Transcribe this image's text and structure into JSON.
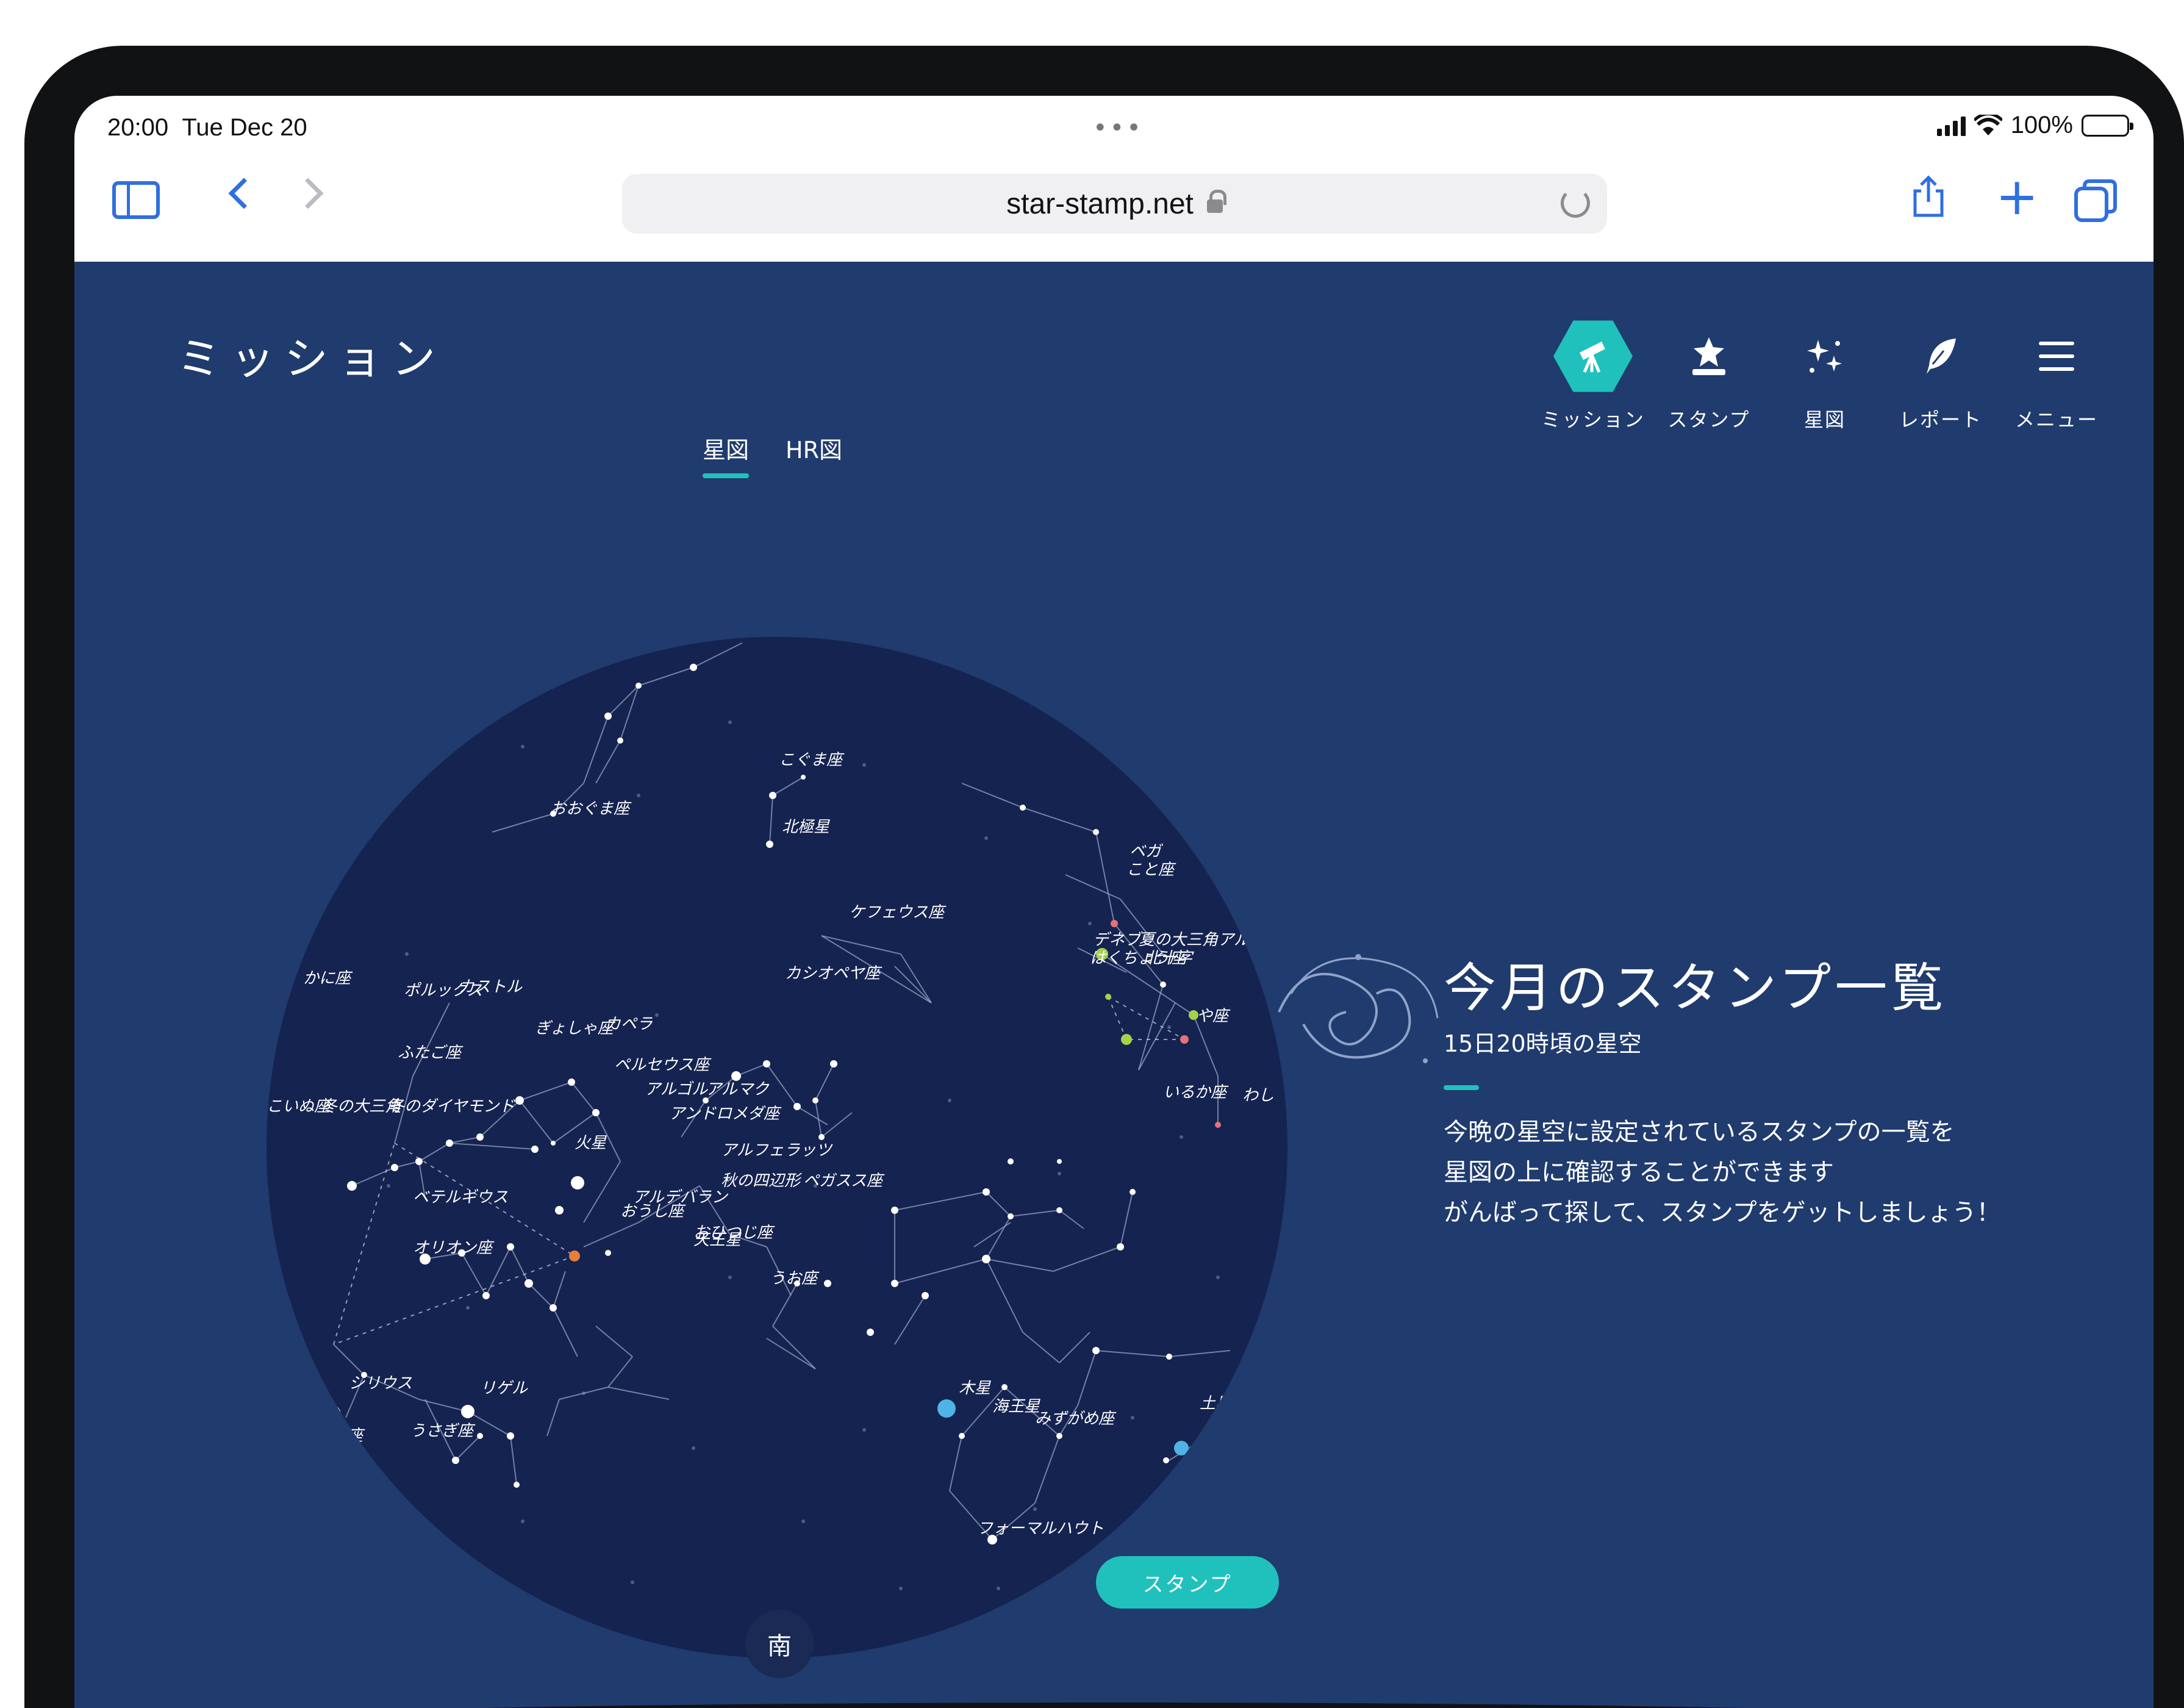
{
  "status_bar": {
    "time": "20:00",
    "date": "Tue Dec 20",
    "dots": "•••",
    "battery": "100%"
  },
  "browser": {
    "url": "star-stamp.net",
    "icons": [
      "sidebar-icon",
      "back-chevron-icon",
      "forward-chevron-icon",
      "lock-icon",
      "reload-icon",
      "share-icon",
      "plus-icon",
      "tabs-icon"
    ]
  },
  "app": {
    "page_title": "ミッション",
    "nav": [
      {
        "label": "ミッション",
        "icon": "telescope-icon",
        "active": true
      },
      {
        "label": "スタンプ",
        "icon": "stamp-icon",
        "active": false
      },
      {
        "label": "星図",
        "icon": "sparkle-stars-icon",
        "active": false
      },
      {
        "label": "レポート",
        "icon": "quill-icon",
        "active": false
      },
      {
        "label": "メニュー",
        "icon": "hamburger-menu-icon",
        "active": false
      }
    ],
    "view_tabs": [
      {
        "label": "星図",
        "active": true
      },
      {
        "label": "HR図",
        "active": false
      }
    ],
    "star_map": {
      "labels": [
        {
          "text": "こぐま座"
        },
        {
          "text": "北極星"
        },
        {
          "text": "おおぐま座"
        },
        {
          "text": "ケフェウス座"
        },
        {
          "text": "ベガ"
        },
        {
          "text": "こと座"
        },
        {
          "text": "デネブ"
        },
        {
          "text": "夏の大三角"
        },
        {
          "text": "アルビレオ"
        },
        {
          "text": "はくちょう座"
        },
        {
          "text": "北十字"
        },
        {
          "text": "や座"
        },
        {
          "text": "いるか座"
        },
        {
          "text": "わし"
        },
        {
          "text": "カシオペヤ座"
        },
        {
          "text": "かに座"
        },
        {
          "text": "ポルックス"
        },
        {
          "text": "カストル"
        },
        {
          "text": "ぎょしゃ座"
        },
        {
          "text": "カペラ"
        },
        {
          "text": "ふたご座"
        },
        {
          "text": "ペルセウス座"
        },
        {
          "text": "アルゴル"
        },
        {
          "text": "アルマク"
        },
        {
          "text": "アンドロメダ座"
        },
        {
          "text": "こいぬ座"
        },
        {
          "text": "冬の大三角"
        },
        {
          "text": "冬のダイヤモンド"
        },
        {
          "text": "火星"
        },
        {
          "text": "アルフェラッツ"
        },
        {
          "text": "秋の四辺形"
        },
        {
          "text": "ペガスス座"
        },
        {
          "text": "ベテルギウス"
        },
        {
          "text": "アルデバラン"
        },
        {
          "text": "おうし座"
        },
        {
          "text": "おひつじ座"
        },
        {
          "text": "天王星"
        },
        {
          "text": "オリオン座"
        },
        {
          "text": "うお座"
        },
        {
          "text": "シリウス"
        },
        {
          "text": "リゲル"
        },
        {
          "text": "木星"
        },
        {
          "text": "海王星"
        },
        {
          "text": "みずがめ座"
        },
        {
          "text": "土星"
        },
        {
          "text": "やぎ"
        },
        {
          "text": "いぬ座"
        },
        {
          "text": "うさぎ座"
        },
        {
          "text": "フォーマルハウト"
        }
      ],
      "direction_label": "南",
      "colors": {
        "sky": "#152350",
        "lines": "#9aa9c9",
        "stars": "#ffffff",
        "planet_mars": "#e67e3c",
        "planet_jupiter": "#4fb3e6",
        "planet_saturn": "#4fb3e6",
        "summer_stars": "#a4d24a",
        "red_stars": "#e8707a"
      }
    },
    "stamp_button": "スタンプ",
    "info": {
      "title": "今月のスタンプ一覧",
      "subtitle": "15日20時頃の星空",
      "body": [
        "今晩の星空に設定されているスタンプの一覧を",
        "星図の上に確認することができます",
        "がんばって探して、スタンプをゲットしましょう！"
      ]
    },
    "colors": {
      "background": "#203b6e",
      "accent": "#20c1bd",
      "text": "#ffffff"
    }
  }
}
